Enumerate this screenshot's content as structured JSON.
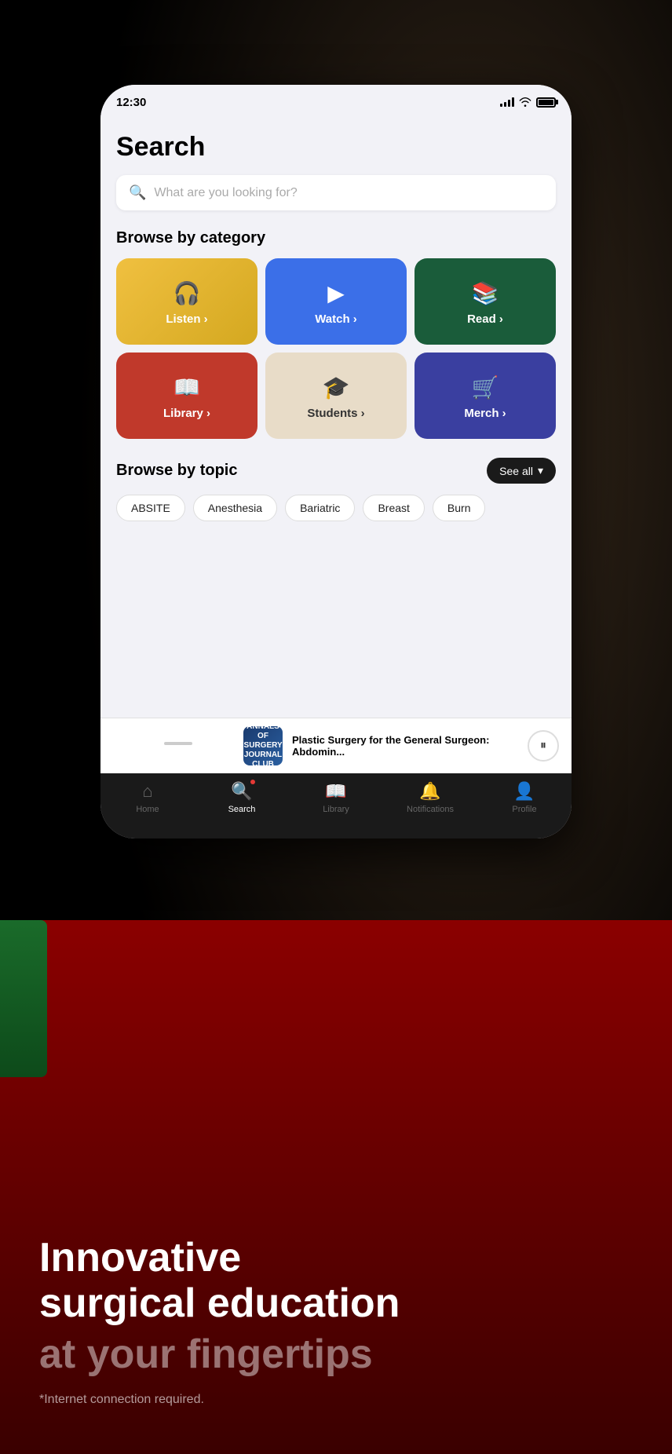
{
  "status_bar": {
    "time": "12:30"
  },
  "page": {
    "title": "Search",
    "search_placeholder": "What are you looking for?"
  },
  "category_section": {
    "label": "Browse by category"
  },
  "categories": [
    {
      "id": "listen",
      "label": "Listen ›",
      "icon": "🎧",
      "style": "card-listen"
    },
    {
      "id": "watch",
      "label": "Watch ›",
      "icon": "▶",
      "style": "card-watch"
    },
    {
      "id": "read",
      "label": "Read ›",
      "icon": "📚",
      "style": "card-read"
    },
    {
      "id": "library",
      "label": "Library ›",
      "icon": "📖",
      "style": "card-library"
    },
    {
      "id": "students",
      "label": "Students ›",
      "icon": "🎓",
      "style": "card-students"
    },
    {
      "id": "merch",
      "label": "Merch ›",
      "icon": "🛒",
      "style": "card-merch"
    }
  ],
  "topic_section": {
    "label": "Browse by topic",
    "see_all": "See all",
    "topics": [
      "ABSITE",
      "Anesthesia",
      "Bariatric",
      "Breast",
      "Burn"
    ]
  },
  "mini_player": {
    "title": "Plastic Surgery for the General Surgeon: Abdomin...",
    "thumbnail_text": "ANNALS OF SURGERY JOURNAL CLUB"
  },
  "bottom_nav": {
    "items": [
      {
        "id": "home",
        "label": "Home",
        "icon": "⌂",
        "active": false
      },
      {
        "id": "search",
        "label": "Search",
        "icon": "⌕",
        "active": true
      },
      {
        "id": "library",
        "label": "Library",
        "icon": "📖",
        "active": false
      },
      {
        "id": "notifications",
        "label": "Notifications",
        "icon": "🔔",
        "active": false
      },
      {
        "id": "profile",
        "label": "Profile",
        "icon": "👤",
        "active": false
      }
    ]
  },
  "tagline": {
    "line1": "Innovative",
    "line2": "surgical education",
    "line3": "at your fingertips",
    "note": "*Internet connection required."
  }
}
